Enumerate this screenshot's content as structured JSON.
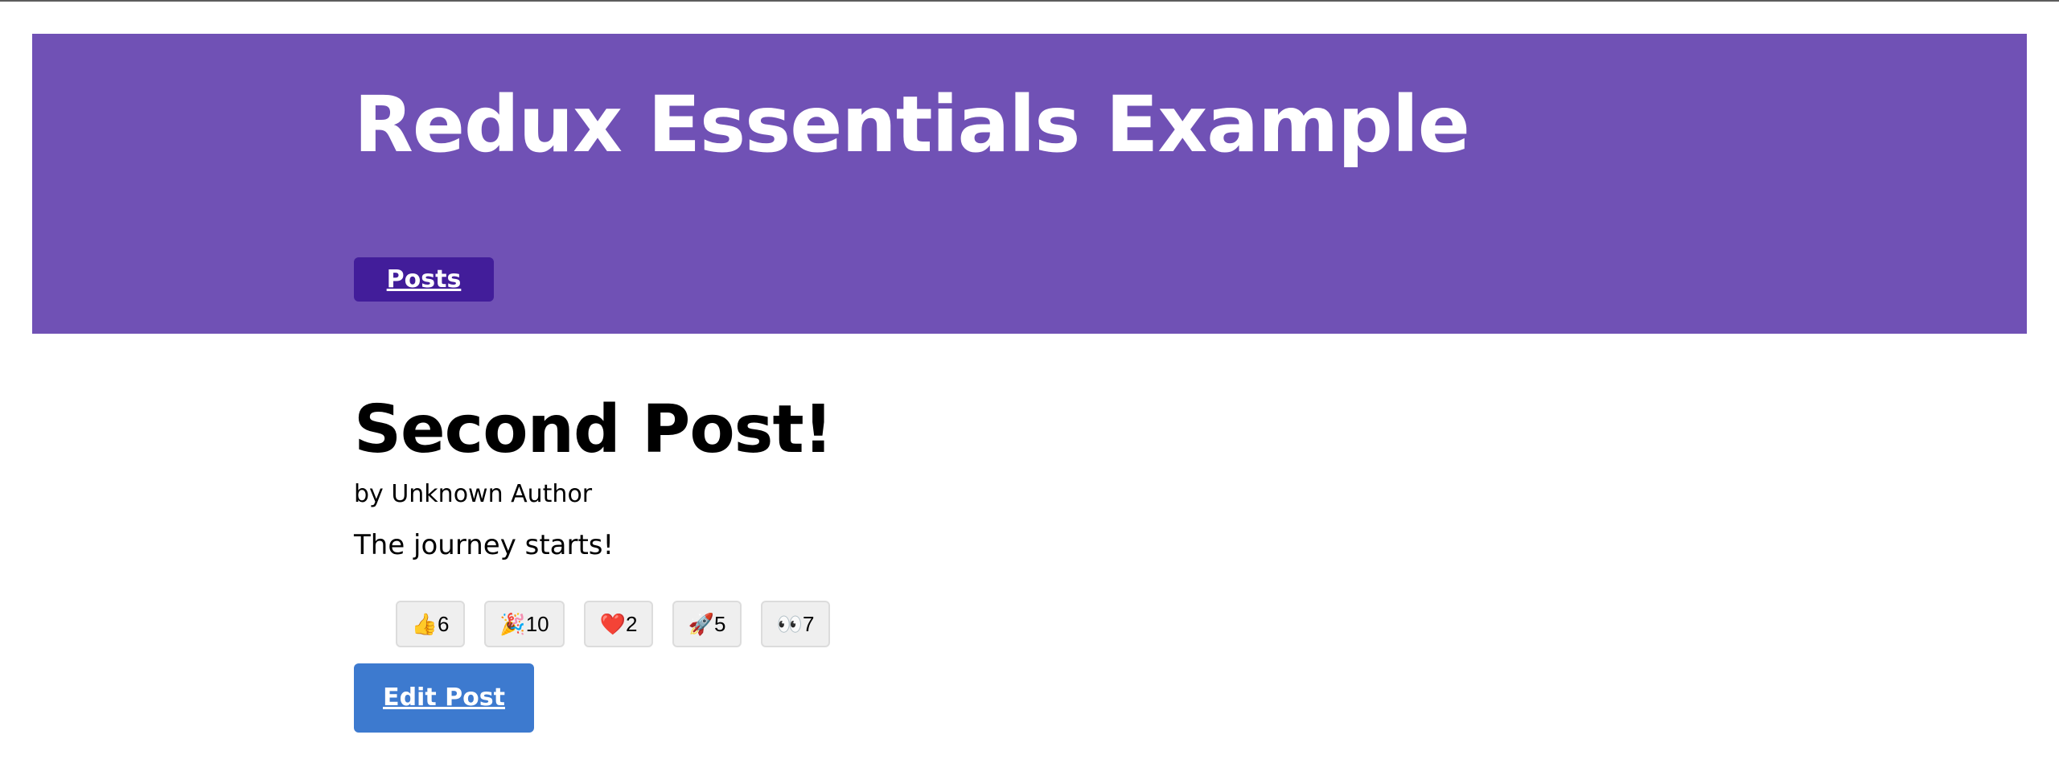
{
  "app": {
    "title": "Redux Essentials Example"
  },
  "nav": {
    "links": [
      {
        "label": "Posts"
      }
    ]
  },
  "post": {
    "title": "Second Post!",
    "author": "by Unknown Author",
    "content": "The journey starts!",
    "reactions": [
      {
        "icon": "thumbs-up-icon",
        "emoji": "👍",
        "count": "6"
      },
      {
        "icon": "party-popper-icon",
        "emoji": "🎉",
        "count": "10"
      },
      {
        "icon": "heart-icon",
        "emoji": "❤️",
        "count": "2"
      },
      {
        "icon": "rocket-icon",
        "emoji": "🚀",
        "count": "5"
      },
      {
        "icon": "eyes-icon",
        "emoji": "👀",
        "count": "7"
      }
    ],
    "edit_label": "Edit Post"
  },
  "colors": {
    "navbar": "#7051b5",
    "nav_link": "#421d9a",
    "edit_button": "#3d7acf"
  }
}
